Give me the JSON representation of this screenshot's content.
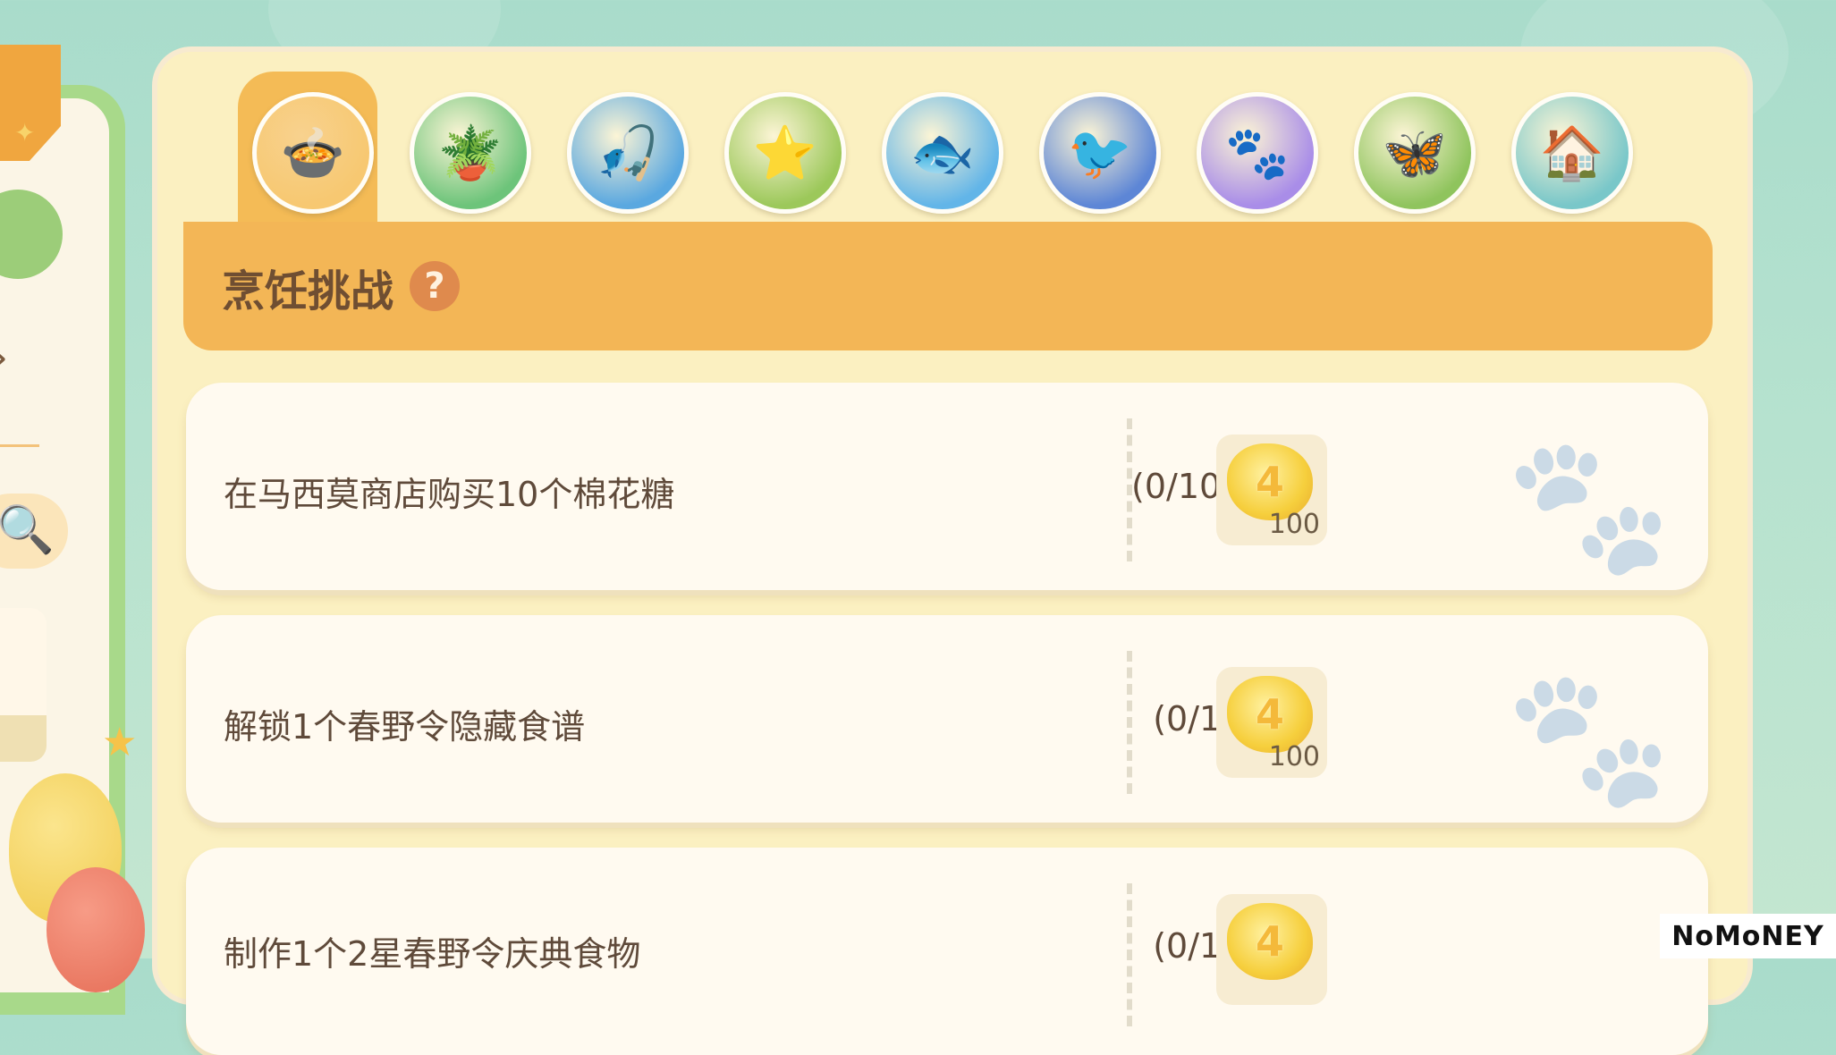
{
  "tabs": [
    {
      "name": "cooking-tab",
      "icon": "🍲",
      "bg": "#f7c871",
      "active": true
    },
    {
      "name": "gardening-tab",
      "icon": "🪴",
      "bg": "#6dc47a",
      "active": false
    },
    {
      "name": "fishing-tab",
      "icon": "🎣",
      "bg": "#5aa8e0",
      "active": false
    },
    {
      "name": "insect-star-tab",
      "icon": "⭐",
      "bg": "#9cc85a",
      "active": false
    },
    {
      "name": "fish-tab",
      "icon": "🐟",
      "bg": "#62b5e8",
      "active": false
    },
    {
      "name": "bird-tab",
      "icon": "🐦",
      "bg": "#5d86d6",
      "active": false
    },
    {
      "name": "paw-tab",
      "icon": "🐾",
      "bg": "#a98de8",
      "active": false
    },
    {
      "name": "butterfly-tab",
      "icon": "🦋",
      "bg": "#8fc45d",
      "active": false
    },
    {
      "name": "house-tab",
      "icon": "🏠",
      "bg": "#79c7c9",
      "active": false
    }
  ],
  "header": {
    "title": "烹饪挑战",
    "help": "?"
  },
  "tasks": [
    {
      "text": "在马西莫商店购买10个棉花糖",
      "progress": "(0/10)",
      "reward_count": "100"
    },
    {
      "text": "解锁1个春野令隐藏食谱",
      "progress": "(0/1)",
      "reward_count": "100"
    },
    {
      "text": "制作1个2星春野令庆典食物",
      "progress": "(0/1)",
      "reward_count": ""
    }
  ],
  "sidebar": {
    "search_icon": "🔍"
  },
  "watermark": "NoMoNEY"
}
